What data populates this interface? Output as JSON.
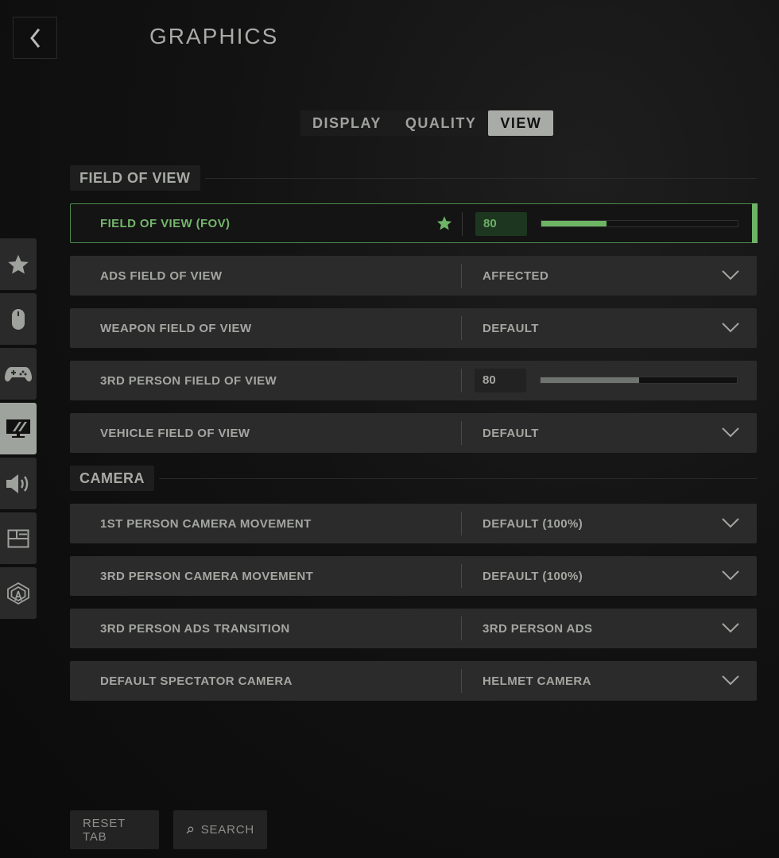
{
  "header": {
    "title": "GRAPHICS",
    "back_icon": "chevron-left-icon"
  },
  "tabs": [
    {
      "label": "DISPLAY",
      "active": false
    },
    {
      "label": "QUALITY",
      "active": false
    },
    {
      "label": "VIEW",
      "active": true
    }
  ],
  "sidenav": [
    {
      "icon": "star-icon",
      "name": "favorites",
      "active": false
    },
    {
      "icon": "mouse-icon",
      "name": "mouse",
      "active": false
    },
    {
      "icon": "gamepad-icon",
      "name": "controller",
      "active": false
    },
    {
      "icon": "monitor-icon",
      "name": "graphics",
      "active": true
    },
    {
      "icon": "speaker-icon",
      "name": "audio",
      "active": false
    },
    {
      "icon": "interface-icon",
      "name": "interface",
      "active": false
    },
    {
      "icon": "network-icon",
      "name": "account-network",
      "active": false
    }
  ],
  "sections": {
    "fov": {
      "title": "FIELD OF VIEW",
      "rows": [
        {
          "label": "FIELD OF VIEW (FOV)",
          "type": "slider",
          "value": "80",
          "fill_percent": 33,
          "favorite": true,
          "selected": true
        },
        {
          "label": "ADS FIELD OF VIEW",
          "type": "dropdown",
          "value": "AFFECTED"
        },
        {
          "label": "WEAPON FIELD OF VIEW",
          "type": "dropdown",
          "value": "DEFAULT"
        },
        {
          "label": "3RD PERSON FIELD OF VIEW",
          "type": "slider",
          "value": "80",
          "fill_percent": 50
        },
        {
          "label": "VEHICLE FIELD OF VIEW",
          "type": "dropdown",
          "value": "DEFAULT"
        }
      ]
    },
    "camera": {
      "title": "CAMERA",
      "rows": [
        {
          "label": "1ST PERSON CAMERA MOVEMENT",
          "type": "dropdown",
          "value": "DEFAULT (100%)"
        },
        {
          "label": "3RD PERSON CAMERA MOVEMENT",
          "type": "dropdown",
          "value": "DEFAULT (100%)"
        },
        {
          "label": "3RD PERSON ADS TRANSITION",
          "type": "dropdown",
          "value": "3RD PERSON ADS"
        },
        {
          "label": "DEFAULT SPECTATOR CAMERA",
          "type": "dropdown",
          "value": "HELMET CAMERA"
        }
      ]
    }
  },
  "footer": {
    "reset_label": "RESET TAB",
    "search_label": "SEARCH"
  },
  "colors": {
    "accent_green": "#6db565",
    "active_tab": "#a9aba7"
  }
}
